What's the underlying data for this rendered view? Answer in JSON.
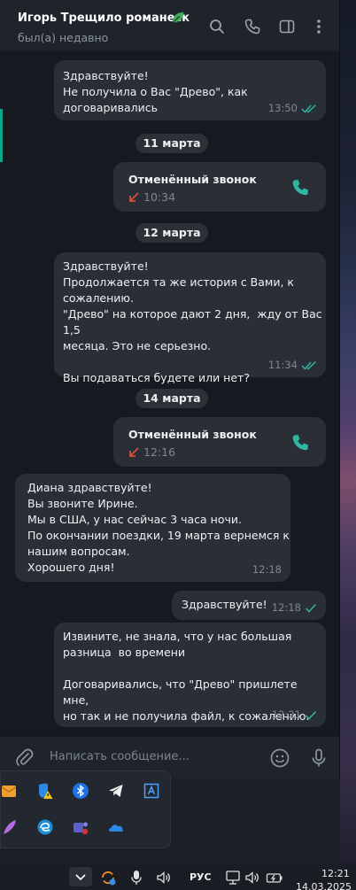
{
  "header": {
    "title": "Игорь Трещило романеск",
    "status": "был(а) недавно"
  },
  "messages": [
    {
      "kind": "text",
      "direction": "out",
      "text": "Здравствуйте!\nНе получила о Вас \"Древо\", как\nдоговаривались",
      "time": "13:50",
      "read": true
    },
    {
      "kind": "date",
      "text": "11 марта"
    },
    {
      "kind": "call",
      "direction": "out",
      "title": "Отменённый звонок",
      "time": "10:34"
    },
    {
      "kind": "date",
      "text": "12 марта"
    },
    {
      "kind": "text",
      "direction": "out",
      "text": "Здравствуйте!\nПродолжается та же история с Вами, к\nсожалению.\n\"Древо\" на которое дают 2 дня,  жду от Вас 1,5\nмесяца. Это не серьезно.\n\nВы подаваться будете или нет?",
      "time": "11:34",
      "read": true
    },
    {
      "kind": "date",
      "text": "14 марта"
    },
    {
      "kind": "call",
      "direction": "out",
      "title": "Отменённый звонок",
      "time": "12:16"
    },
    {
      "kind": "text",
      "direction": "in",
      "text": "Диана здравствуйте!\nВы звоните Ирине.\nМы в США, у нас сейчас 3 часа ночи.\nПо окончании поездки, 19 марта вернемся к\nнашим вопросам.\nХорошего дня!",
      "time": "12:18"
    },
    {
      "kind": "text",
      "direction": "out",
      "text": "Здравствуйте!",
      "time": "12:18",
      "read": false
    },
    {
      "kind": "text",
      "direction": "out",
      "text": "Извините, не знала, что у нас большая\nразница  во времени\n\nДоговаривались, что \"Древо\" пришлете мне,\nно так и не получила файл, к сожалению.",
      "time": "12:21",
      "read": false
    }
  ],
  "composer": {
    "placeholder": "Написать сообщение..."
  },
  "taskbar": {
    "language": "РУС",
    "time": "12:21",
    "date": "14.03.2025"
  },
  "colors": {
    "accent": "#2fb6a0",
    "missed_call": "#e5533d",
    "bubble": "#2a2f37",
    "chat_bg": "#16191f"
  }
}
